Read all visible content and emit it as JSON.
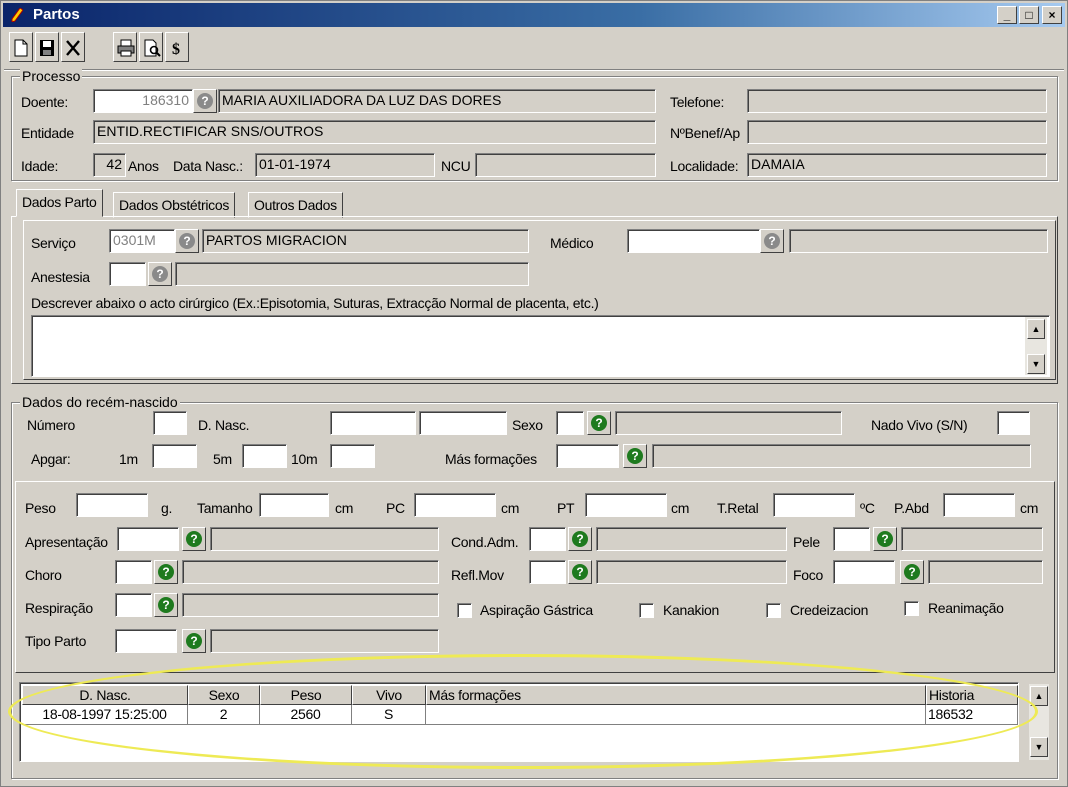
{
  "window": {
    "title": "Partos"
  },
  "processo": {
    "legend": "Processo",
    "doente_label": "Doente:",
    "doente_id": "186310",
    "doente_nome": "MARIA AUXILIADORA DA LUZ DAS DORES",
    "telefone_label": "Telefone:",
    "telefone": "",
    "entidade_label": "Entidade",
    "entidade": "ENTID.RECTIFICAR SNS/OUTROS",
    "nbenef_label": "NºBenef/Ap",
    "nbenef": "",
    "idade_label": "Idade:",
    "idade": "42",
    "anos_label": "Anos",
    "data_nasc_label": "Data Nasc.:",
    "data_nasc": "01-01-1974",
    "ncu_label": "NCU",
    "ncu": "",
    "localidade_label": "Localidade:",
    "localidade": "DAMAIA"
  },
  "tabs": [
    "Dados Parto",
    "Dados Obstétricos",
    "Outros Dados"
  ],
  "dados_parto": {
    "servico_label": "Serviço",
    "servico_code": "0301M",
    "servico_nome": "PARTOS MIGRACION",
    "medico_label": "Médico",
    "medico": "",
    "anestesia_label": "Anestesia",
    "descrever_label": "Descrever abaixo o acto cirúrgico (Ex.:Episotomia, Suturas, Extracção Normal de placenta, etc.)"
  },
  "recem_nascido": {
    "legend": "Dados do recém-nascido",
    "numero_label": "Número",
    "dnasc_label": "D. Nasc.",
    "sexo_label": "Sexo",
    "nado_vivo_label": "Nado Vivo (S/N)",
    "apgar_label": "Apgar:",
    "apgar_1m": "1m",
    "apgar_5m": "5m",
    "apgar_10m": "10m",
    "mas_formacoes_label": "Más formações"
  },
  "medidas": {
    "peso_label": "Peso",
    "peso_unit": "g.",
    "tamanho_label": "Tamanho",
    "tamanho_unit": "cm",
    "pc_label": "PC",
    "pc_unit": "cm",
    "pt_label": "PT",
    "pt_unit": "cm",
    "tretal_label": "T.Retal",
    "tretal_unit": "ºC",
    "pabd_label": "P.Abd",
    "pabd_unit": "cm",
    "apresentacao_label": "Apresentação",
    "cond_adm_label": "Cond.Adm.",
    "pele_label": "Pele",
    "choro_label": "Choro",
    "refl_mov_label": "Refl.Mov",
    "foco_label": "Foco",
    "respiracao_label": "Respiração",
    "aspiracao_label": "Aspiração Gástrica",
    "kanakion_label": "Kanakion",
    "credeizacion_label": "Credeizacion",
    "reanimacao_label": "Reanimação",
    "tipo_parto_label": "Tipo Parto"
  },
  "grid": {
    "columns": [
      "D. Nasc.",
      "Sexo",
      "Peso",
      "Vivo",
      "Más formações",
      "Historia"
    ],
    "rows": [
      [
        "18-08-1997 15:25:00",
        "2",
        "2560",
        "S",
        "",
        "186532"
      ]
    ]
  },
  "colors": {
    "title_start": "#0a246a",
    "title_end": "#a6caf0",
    "highlight": "#eeea55",
    "help_green": "#1e7a1e"
  },
  "icons": [
    "app-pen-icon",
    "new-document-icon",
    "save-icon",
    "delete-icon",
    "print-icon",
    "print-preview-icon",
    "dollar-icon",
    "help-question-icon",
    "scroll-up-icon",
    "scroll-down-icon"
  ]
}
